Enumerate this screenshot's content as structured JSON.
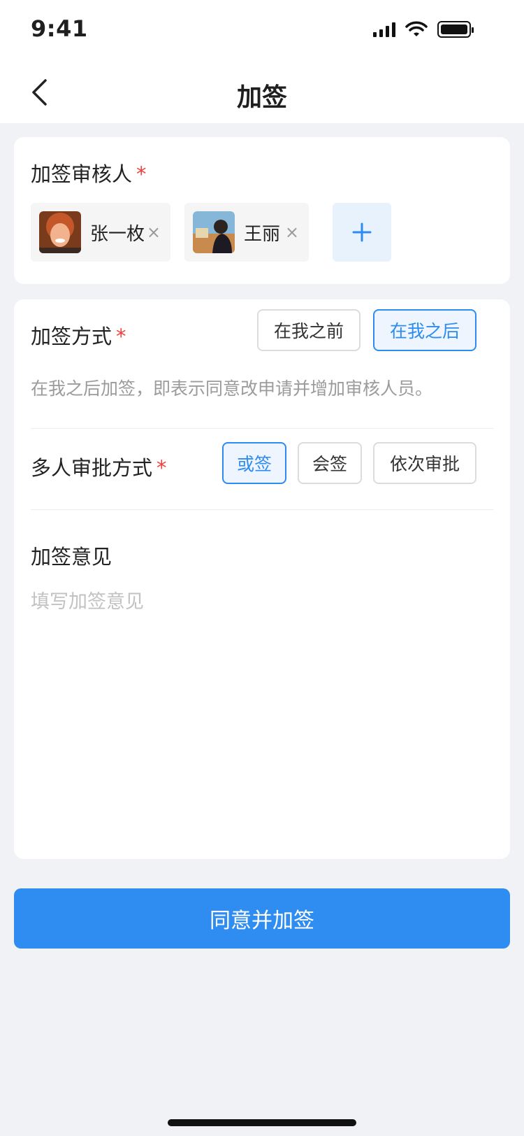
{
  "status_bar": {
    "time": "9:41"
  },
  "nav": {
    "title": "加签"
  },
  "approvers": {
    "label": "加签审核人",
    "required_mark": "*",
    "people": [
      {
        "name": "张一枚",
        "remove": "×"
      },
      {
        "name": "王丽",
        "remove": "×"
      }
    ],
    "add_icon": "plus-icon"
  },
  "sign_method": {
    "label": "加签方式",
    "required_mark": "*",
    "options": [
      "在我之前",
      "在我之后"
    ],
    "selected": "在我之后",
    "hint": "在我之后加签，即表示同意改申请并增加审核人员。"
  },
  "multi_approval": {
    "label": "多人审批方式",
    "required_mark": "*",
    "options": [
      "或签",
      "会签",
      "依次审批"
    ],
    "selected": "或签"
  },
  "opinion": {
    "label": "加签意见",
    "placeholder": "填写加签意见",
    "value": ""
  },
  "submit": {
    "label": "同意并加签"
  },
  "colors": {
    "accent": "#2f8cf0",
    "required": "#ef4040",
    "background": "#f0f2f5"
  }
}
